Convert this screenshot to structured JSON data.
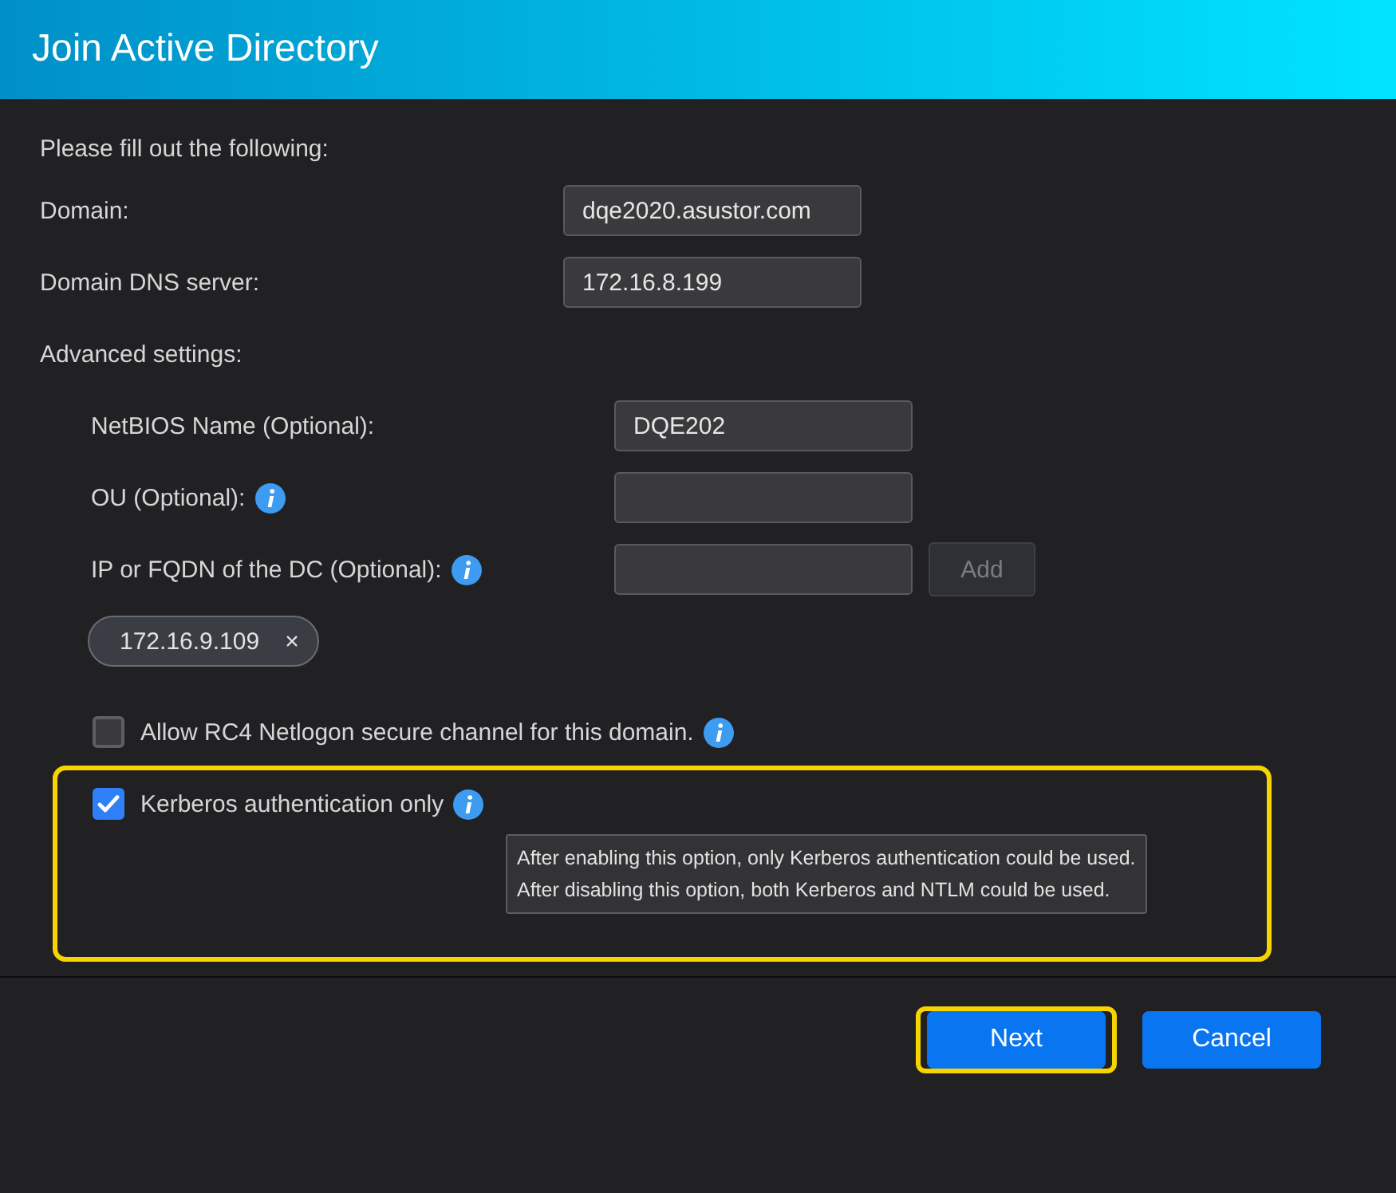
{
  "window": {
    "title": "Join Active Directory"
  },
  "intro": "Please fill out the following:",
  "fields": [
    {
      "label": "Domain:",
      "value": "dqe2020.asustor.com",
      "info": false
    },
    {
      "label": "Domain DNS server:",
      "value": "172.16.8.199",
      "info": false
    }
  ],
  "advanced": {
    "label": "Advanced settings:",
    "fields": [
      {
        "label": "NetBIOS Name (Optional):",
        "value": "DQE202",
        "info": false
      },
      {
        "label": "OU (Optional):",
        "info": true
      },
      {
        "label": "IP or FQDN of the DC (Optional):",
        "info": true,
        "button": {
          "label": "Add",
          "disabled": true
        }
      }
    ],
    "chips": [
      {
        "label": "172.16.9.109",
        "remove": "×"
      }
    ],
    "options": [
      {
        "label": "Allow RC4 Netlogon secure channel for this domain.",
        "checked": false,
        "info": true,
        "highlighted": false
      },
      {
        "label": "Kerberos authentication only",
        "checked": true,
        "info": true,
        "highlighted": true,
        "tooltip": [
          "After enabling this option, only Kerberos authentication could be used.",
          "After disabling this option, both Kerberos and NTLM could be used."
        ]
      }
    ]
  },
  "buttons": [
    {
      "label": "Next",
      "highlighted": true
    },
    {
      "label": "Cancel",
      "highlighted": false
    }
  ]
}
